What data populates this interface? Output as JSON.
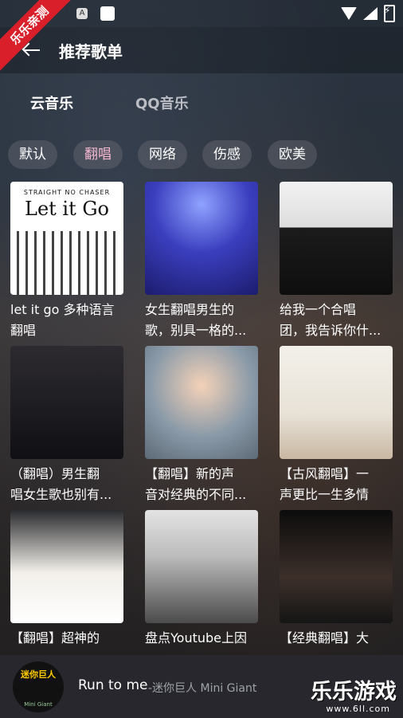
{
  "status_bar": {
    "icon_a": "A"
  },
  "app_bar": {
    "title": "推荐歌单",
    "back_icon": "back-arrow-icon"
  },
  "watermark": {
    "ribbon": "乐乐亲测",
    "logo": "乐乐游戏",
    "url": "www.6ll.com"
  },
  "tabs": [
    {
      "label": "云音乐",
      "active": true
    },
    {
      "label": "QQ音乐",
      "active": false
    }
  ],
  "chips": [
    {
      "label": "默认",
      "active": false
    },
    {
      "label": "翻唱",
      "active": true
    },
    {
      "label": "网络",
      "active": false
    },
    {
      "label": "伤感",
      "active": false
    },
    {
      "label": "欧美",
      "active": false
    }
  ],
  "playlists": [
    {
      "title_line1": "let it go 多种语言",
      "title_line2": "翻唱",
      "thumb_text_1": "STRAIGHT NO CHASER",
      "thumb_text_2": "Let it Go"
    },
    {
      "title_line1": "女生翻唱男生的",
      "title_line2": "歌，别具一格的..."
    },
    {
      "title_line1": "给我一个合唱",
      "title_line2": "团，我告诉你什..."
    },
    {
      "title_line1": "（翻唱）男生翻",
      "title_line2": "唱女生歌也别有..."
    },
    {
      "title_line1": "【翻唱】新的声",
      "title_line2": "音对经典的不同..."
    },
    {
      "title_line1": "【古风翻唱】一",
      "title_line2": "声更比一生多情"
    },
    {
      "title_line1": "【翻唱】超神的",
      "title_line2": ""
    },
    {
      "title_line1": "盘点Youtube上因",
      "title_line2": ""
    },
    {
      "title_line1": "【经典翻唱】大",
      "title_line2": ""
    }
  ],
  "now_playing": {
    "title": "Run to me",
    "artist": "-迷你巨人 Mini Giant",
    "album_label": "迷你巨人",
    "album_sub": "Mini Giant"
  },
  "colors": {
    "accent_chip": "#f7b8d0",
    "ribbon": "#d9202a"
  }
}
